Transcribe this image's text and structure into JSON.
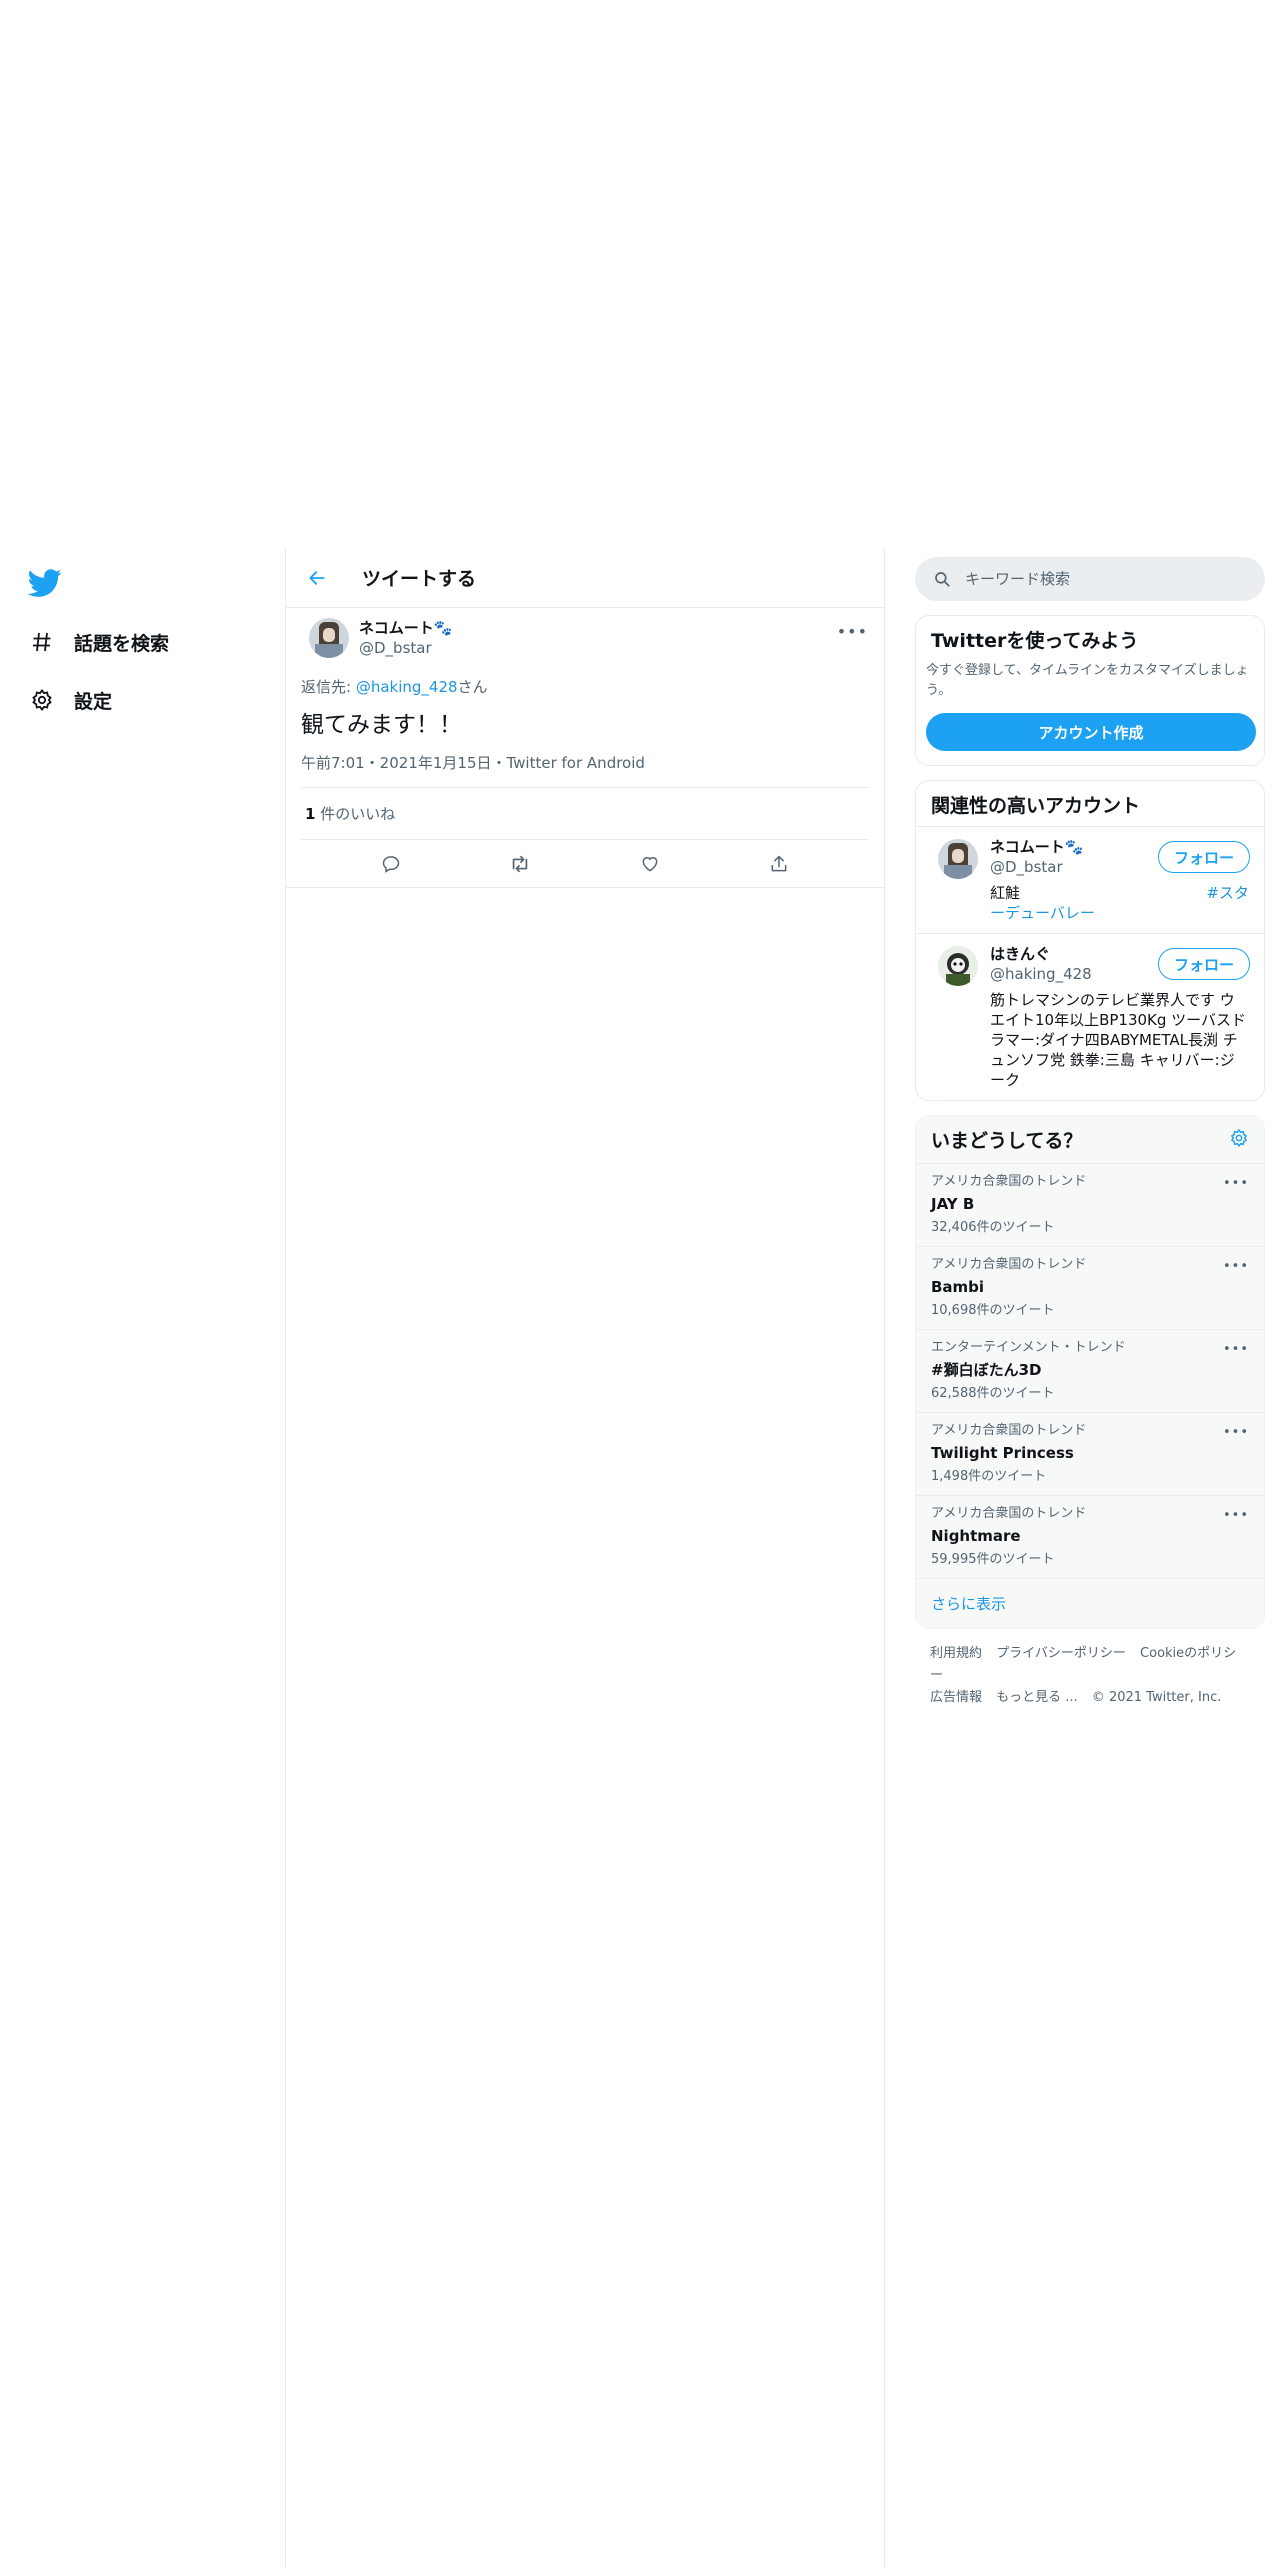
{
  "nav": {
    "items": [
      {
        "icon": "hashtag-icon",
        "label": "話題を検索"
      },
      {
        "icon": "gear-icon",
        "label": "設定"
      }
    ]
  },
  "header": {
    "title": "ツイートする"
  },
  "tweet": {
    "display_name": "ネコムート🐾",
    "handle": "@D_bstar",
    "reply_prefix": "返信先:",
    "reply_mention": "@haking_428",
    "reply_suffix": "さん",
    "text": "観てみます！！",
    "meta": "午前7:01・2021年1月15日・Twitter for Android",
    "likes_count": "1",
    "likes_label": "件のいいね",
    "more": "•••"
  },
  "search": {
    "placeholder": "キーワード検索"
  },
  "signup": {
    "title": "Twitterを使ってみよう",
    "description": "今すぐ登録して、タイムラインをカスタマイズしましょう。",
    "button": "アカウント作成"
  },
  "who_to_follow": {
    "title": "関連性の高いアカウント",
    "follow_label": "フォロー",
    "accounts": [
      {
        "name": "ネコムート🐾",
        "handle": "@D_bstar",
        "bio_1": "紅鮭",
        "bio_tag": "#スタ",
        "bio_2": "ーデューバレー"
      },
      {
        "name": "はきんぐ",
        "handle": "@haking_428",
        "bio": "筋トレマシンのテレビ業界人です ウエイト10年以上BP130Kg ツーバスドラマー:ダイナ四BABYMETAL長渕 チュンソフ党 鉄拳:三島 キャリバー:ジーク"
      }
    ]
  },
  "trends": {
    "title": "いまどうしてる？",
    "more": "•••",
    "items": [
      {
        "context": "アメリカ合衆国のトレンド",
        "name": "JAY B",
        "count": "32,406件のツイート"
      },
      {
        "context": "アメリカ合衆国のトレンド",
        "name": "Bambi",
        "count": "10,698件のツイート"
      },
      {
        "context": "エンターテインメント・トレンド",
        "name": "#獅白ぼたん3D",
        "count": "62,588件のツイート"
      },
      {
        "context": "アメリカ合衆国のトレンド",
        "name": "Twilight Princess",
        "count": "1,498件のツイート"
      },
      {
        "context": "アメリカ合衆国のトレンド",
        "name": "Nightmare",
        "count": "59,995件のツイート"
      }
    ],
    "show_more": "さらに表示"
  },
  "footer": {
    "links": [
      "利用規約",
      "プライバシーポリシー",
      "Cookieのポリシー",
      "広告情報",
      "もっと見る ..."
    ],
    "copyright": "© 2021 Twitter, Inc."
  },
  "colors": {
    "accent": "#1da1f2",
    "link": "#1b95e0",
    "text": "#0f1419",
    "muted": "#536471",
    "border": "#e6ecf0"
  }
}
